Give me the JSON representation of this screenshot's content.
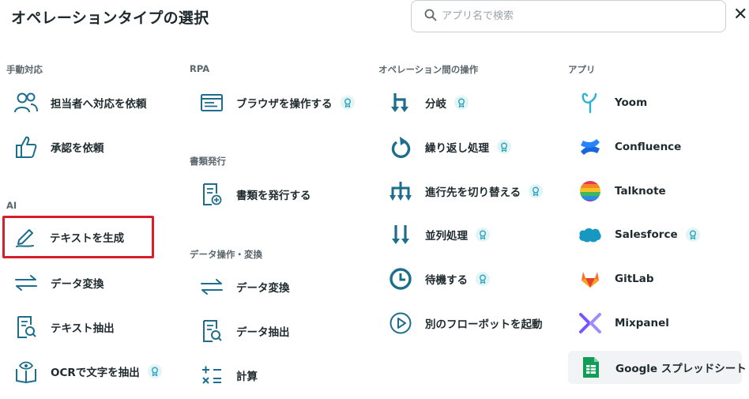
{
  "header": {
    "title": "オペレーションタイプの選択",
    "search_placeholder": "アプリ名で検索",
    "close_label": "✕"
  },
  "columns": {
    "manual": {
      "section": "手動対応",
      "items": [
        "担当者へ対応を依頼",
        "承認を依頼"
      ]
    },
    "ai": {
      "section": "AI",
      "items": [
        "テキストを生成",
        "データ変換",
        "テキスト抽出",
        "OCRで文字を抽出"
      ]
    },
    "rpa": {
      "section": "RPA",
      "items": [
        "ブラウザを操作する"
      ]
    },
    "docs": {
      "section": "書類発行",
      "items": [
        "書類を発行する"
      ]
    },
    "data_ops": {
      "section": "データ操作・変換",
      "items": [
        "データ変換",
        "データ抽出",
        "計算"
      ]
    },
    "flow_ops": {
      "section": "オペレーション間の操作",
      "items": [
        "分岐",
        "繰り返し処理",
        "進行先を切り替える",
        "並列処理",
        "待機する",
        "別のフローボットを起動"
      ]
    },
    "apps": {
      "section": "アプリ",
      "items": [
        "Yoom",
        "Confluence",
        "Talknote",
        "Salesforce",
        "GitLab",
        "Mixpanel",
        "Google スプレッドシート"
      ]
    }
  },
  "colors": {
    "accent": "#1c6e8c",
    "selected_border": "#d81e2a",
    "badge_bg": "#e3f4f7"
  }
}
